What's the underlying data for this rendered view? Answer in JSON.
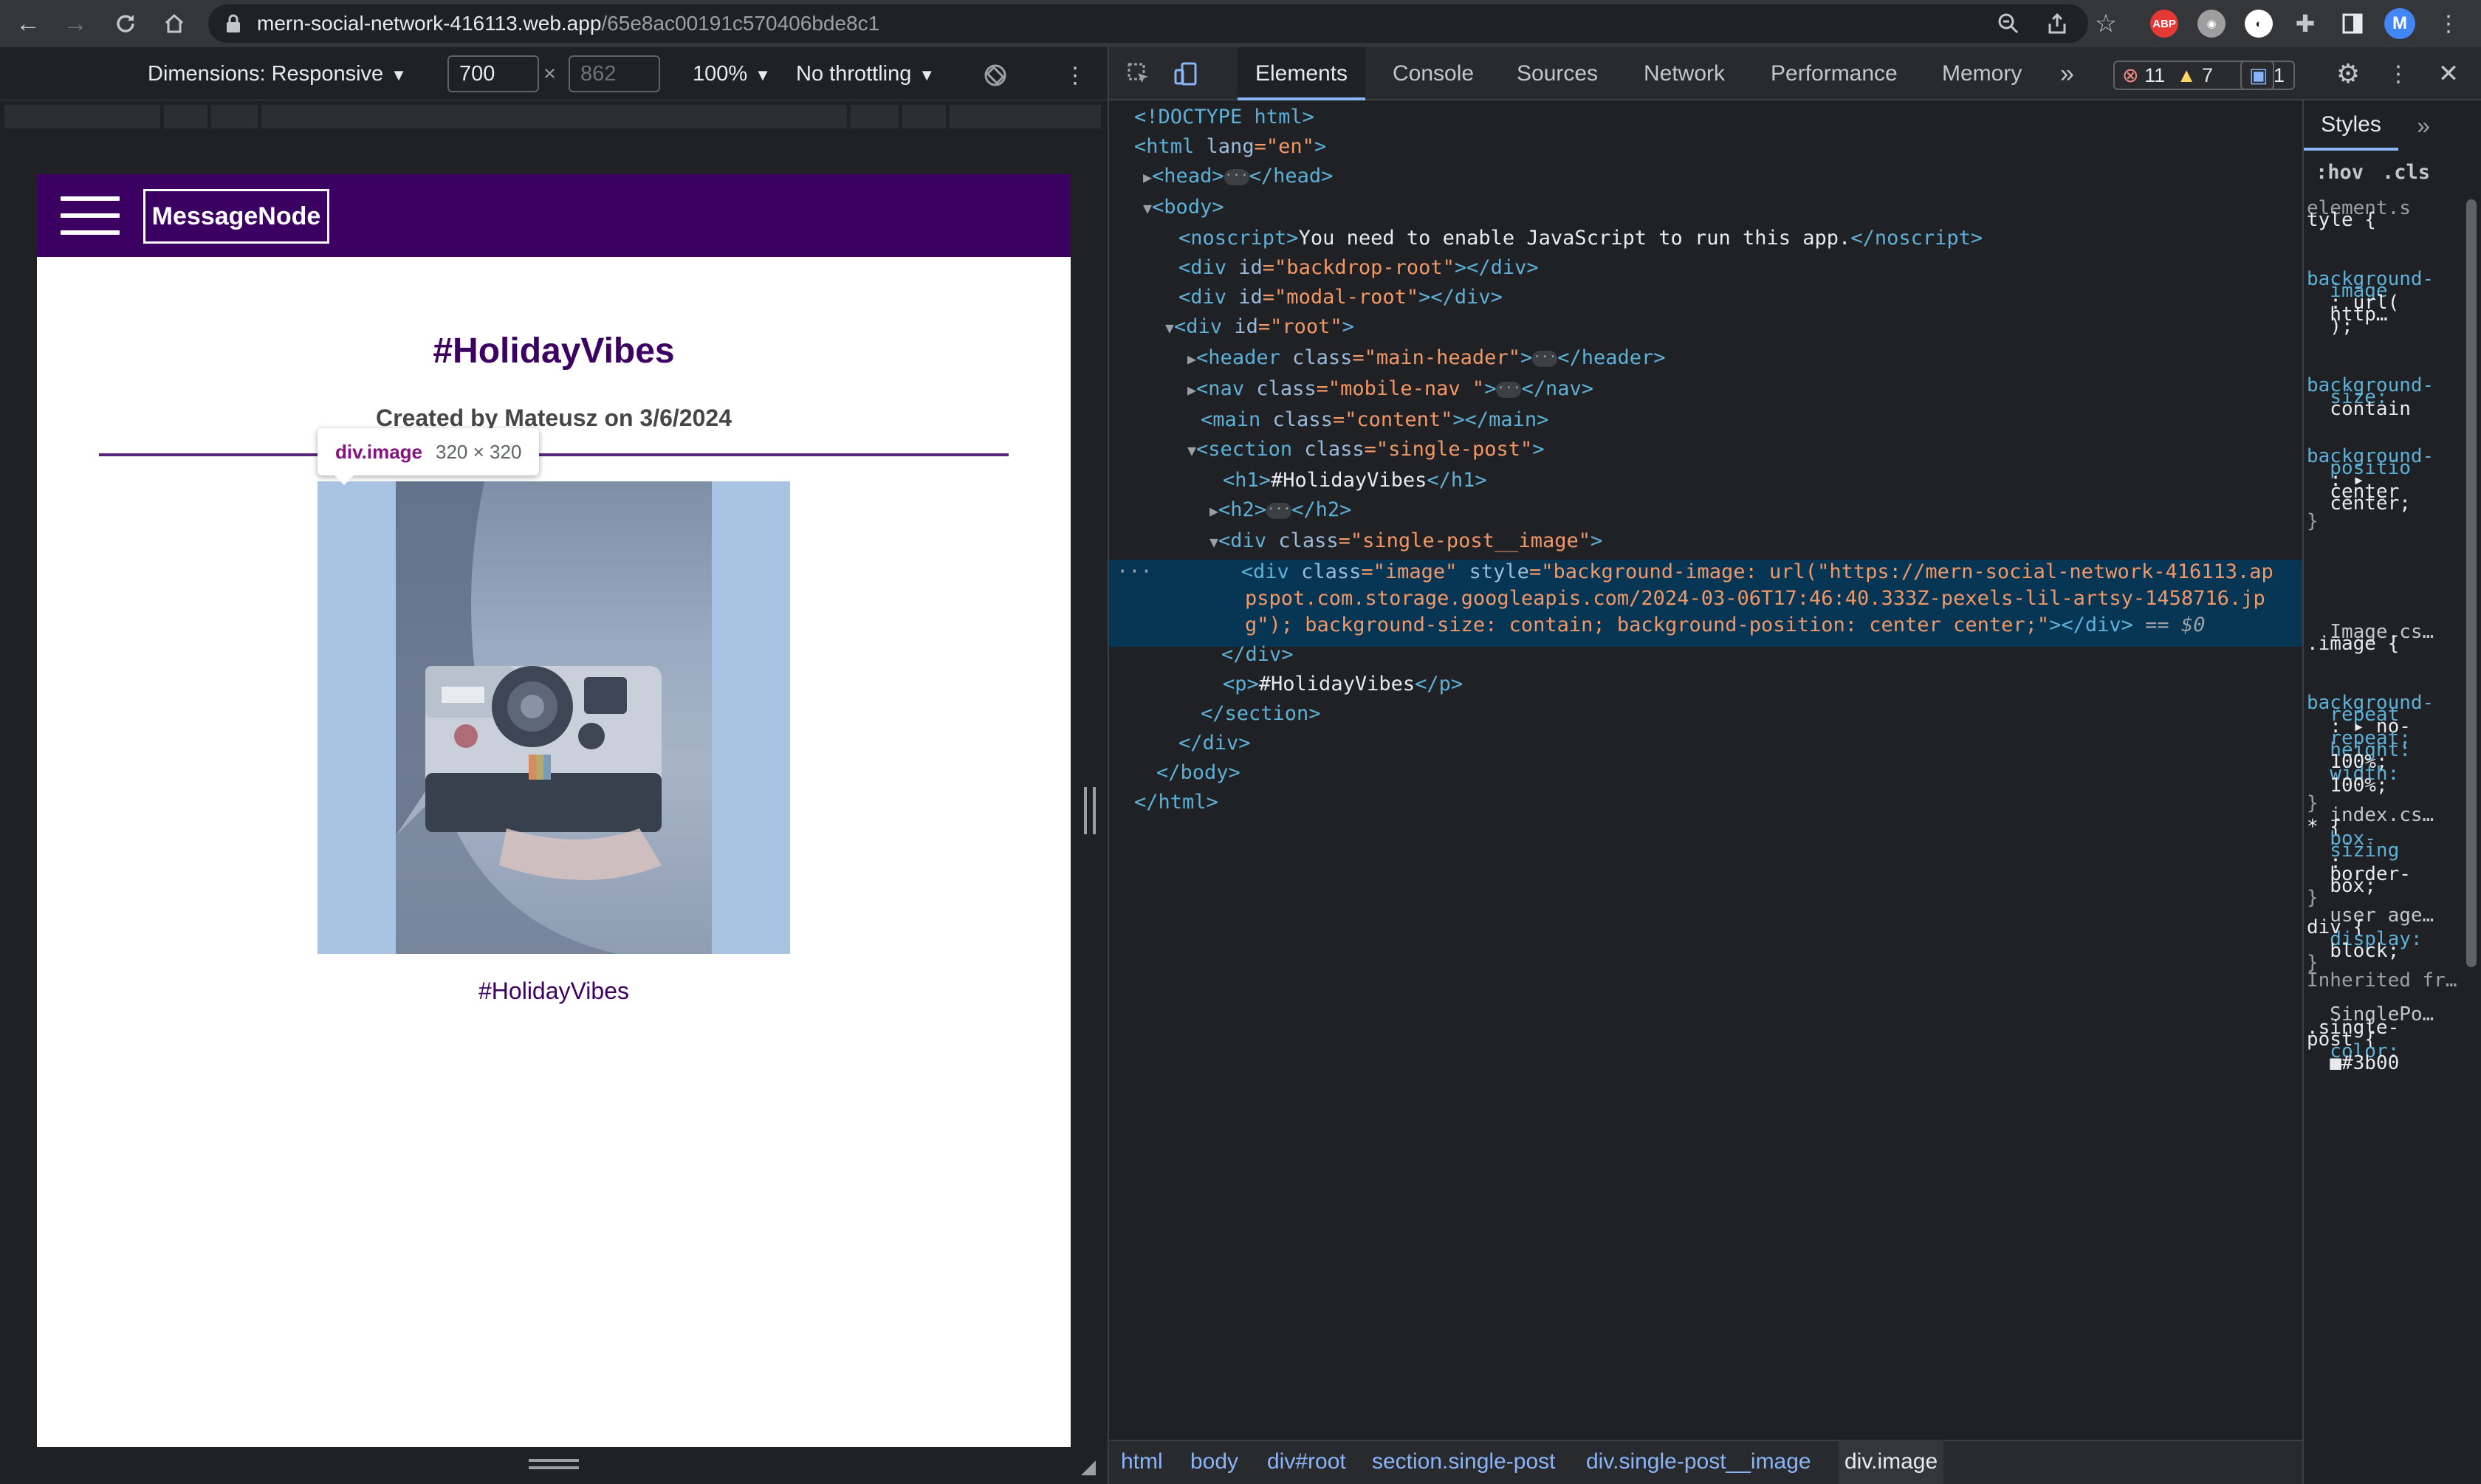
{
  "browser": {
    "url_host": "mern-social-network-416113.web.app",
    "url_path": "/65e8ac00191c570406bde8c1",
    "profile_initial": "M",
    "abp_label": "ABP"
  },
  "device_toolbar": {
    "dimensions_label": "Dimensions: Responsive",
    "width": "700",
    "height": "862",
    "times": "×",
    "zoom": "100%",
    "throttling": "No throttling"
  },
  "page": {
    "logo": "MessageNode",
    "title": "#HolidayVibes",
    "meta": "Created by Mateusz on 3/6/2024",
    "content": "#HolidayVibes",
    "tooltip_selector": "div.image",
    "tooltip_size": "320 × 320"
  },
  "devtools": {
    "tabs": [
      "Elements",
      "Console",
      "Sources",
      "Network",
      "Performance",
      "Memory"
    ],
    "errors": "11",
    "warnings": "7",
    "messages": "1",
    "breadcrumbs": [
      "html",
      "body",
      "div#root",
      "section.single-post",
      "div.single-post__image",
      "div.image"
    ],
    "dom": {
      "l0": "<!DOCTYPE html>",
      "l1a": "<html ",
      "l1b": "lang",
      "l1c": "=\"en\"",
      "l1d": ">",
      "l2a": "<head>",
      "l2b": "</head>",
      "l3": "<body>",
      "l4a": "<noscript>",
      "l4b": "You need to enable JavaScript to run this app.",
      "l4c": "</noscript>",
      "l5a": "<div ",
      "l5b": "id",
      "l5c": "=\"backdrop-root\"",
      "l5d": "></div>",
      "l6a": "<div ",
      "l6b": "id",
      "l6c": "=\"modal-root\"",
      "l6d": "></div>",
      "l7a": "<div ",
      "l7b": "id",
      "l7c": "=\"root\"",
      "l7d": ">",
      "l8a": "<header ",
      "l8b": "class",
      "l8c": "=\"main-header\"",
      "l8d": ">",
      "l8e": "</header>",
      "l9a": "<nav ",
      "l9b": "class",
      "l9c": "=\"mobile-nav \"",
      "l9d": ">",
      "l9e": "</nav>",
      "l10a": "<main ",
      "l10b": "class",
      "l10c": "=\"content\"",
      "l10d": "></main>",
      "l11a": "<section ",
      "l11b": "class",
      "l11c": "=\"single-post\"",
      "l11d": ">",
      "l12a": "<h1>",
      "l12b": "#HolidayVibes",
      "l12c": "</h1>",
      "l13a": "<h2>",
      "l13b": "</h2>",
      "l14a": "<div ",
      "l14b": "class",
      "l14c": "=\"single-post__image\"",
      "l14d": ">",
      "l15a": "<div ",
      "l15b": "class",
      "l15c": "=\"image\" ",
      "l15d": "style",
      "l15e": "=\"background-image: url(\"https://mern-social-network-416113.ap",
      "l16": "pspot.com.storage.googleapis.com/2024-03-06T17:46:40.333Z-pexels-lil-artsy-1458716.jp",
      "l17a": "g\"); background-size: contain; background-position: center center;\"",
      "l17b": "></div>",
      "l17c": " == $0",
      "l18": "</div>",
      "l19a": "<p>",
      "l19b": "#HolidayVibes",
      "l19c": "</p>",
      "l20": "</section>",
      "l21": "</div>",
      "l22": "</body>",
      "l23": "</html>"
    },
    "styles": {
      "tab": "Styles",
      "hov": ":hov",
      "cls": ".cls",
      "lines": [
        "element.s",
        "tyle {",
        "background-",
        "  image",
        "  : url(",
        "  http…",
        "  );",
        "background-",
        "  size:",
        "  contain",
        "background-",
        "  positio",
        "  : ▸",
        "  center",
        "  center;",
        "}",
        "  Image.cs…",
        ".image {",
        "background-",
        "  repeat",
        "  : ▸ no-",
        "  repeat;",
        "  height:",
        "  100%;",
        "  width:",
        "  100%;",
        "}",
        "  index.cs…",
        "* {",
        "  box-",
        "  sizing",
        "  :",
        "  border-",
        "  box;",
        "}",
        "  user age…",
        "div {",
        "  display:",
        "  block;",
        "}",
        "Inherited fr…",
        "  SinglePo…",
        ".single-",
        "post {",
        "  color:",
        "  ■#3b00"
      ]
    }
  },
  "colors": {
    "brand": "#3b0062",
    "selection": "#073655",
    "tag": "#5db0d7",
    "attr_value": "#f29766"
  }
}
